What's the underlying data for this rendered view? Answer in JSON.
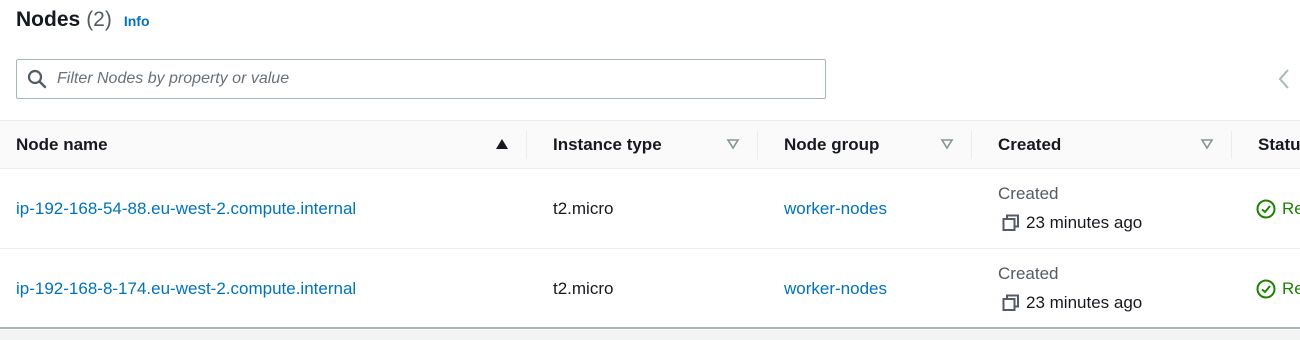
{
  "header": {
    "title": "Nodes",
    "count": "(2)",
    "info_label": "Info"
  },
  "filter": {
    "placeholder": "Filter Nodes by property or value",
    "value": ""
  },
  "table": {
    "columns": [
      {
        "label": "Node name",
        "sort": "ascending"
      },
      {
        "label": "Instance type",
        "sort": "none"
      },
      {
        "label": "Node group",
        "sort": "none"
      },
      {
        "label": "Created",
        "sort": "none"
      },
      {
        "label": "Statu",
        "sort": "none"
      }
    ],
    "rows": [
      {
        "node_name": "ip-192-168-54-88.eu-west-2.compute.internal",
        "instance_type": "t2.micro",
        "node_group": "worker-nodes",
        "created_label": "Created",
        "created_time": "23 minutes ago",
        "status": "Re"
      },
      {
        "node_name": "ip-192-168-8-174.eu-west-2.compute.internal",
        "instance_type": "t2.micro",
        "node_group": "worker-nodes",
        "created_label": "Created",
        "created_time": "23 minutes ago",
        "status": "Re"
      }
    ]
  },
  "colors": {
    "link": "#0073bb",
    "success": "#1d8102",
    "text": "#16191f",
    "muted": "#545b64",
    "border": "#aab7b8"
  }
}
